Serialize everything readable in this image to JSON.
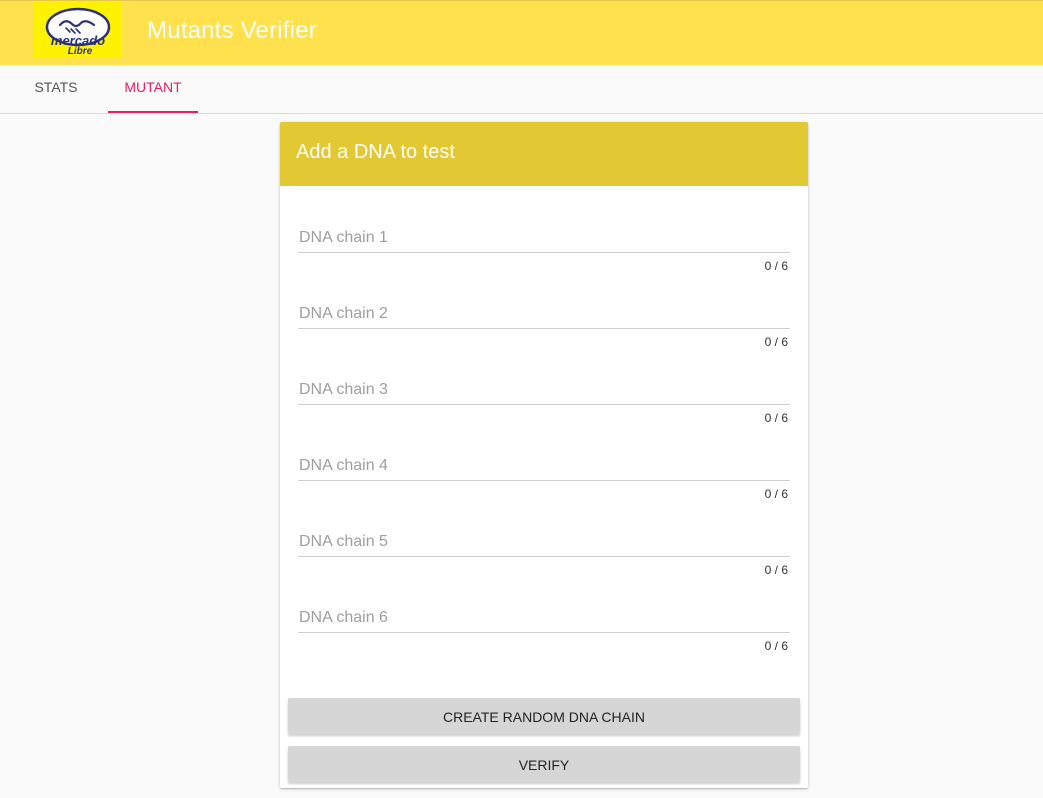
{
  "header": {
    "logo_text_top": "mercado",
    "logo_text_bottom": "Libre",
    "title": "Mutants Verifier",
    "accent_color": "#ffe14d",
    "logo_color": "#fff200"
  },
  "tabs": [
    {
      "label": "STATS",
      "active": false
    },
    {
      "label": "MUTANT",
      "active": true
    }
  ],
  "tab_active_color": "#e91e63",
  "card": {
    "title": "Add a DNA to test",
    "header_color": "#e2c832",
    "fields": [
      {
        "placeholder": "DNA chain 1",
        "value": "",
        "counter": "0 / 6"
      },
      {
        "placeholder": "DNA chain 2",
        "value": "",
        "counter": "0 / 6"
      },
      {
        "placeholder": "DNA chain 3",
        "value": "",
        "counter": "0 / 6"
      },
      {
        "placeholder": "DNA chain 4",
        "value": "",
        "counter": "0 / 6"
      },
      {
        "placeholder": "DNA chain 5",
        "value": "",
        "counter": "0 / 6"
      },
      {
        "placeholder": "DNA chain 6",
        "value": "",
        "counter": "0 / 6"
      }
    ],
    "buttons": {
      "random_label": "CREATE RANDOM DNA CHAIN",
      "verify_label": "VERIFY"
    }
  }
}
